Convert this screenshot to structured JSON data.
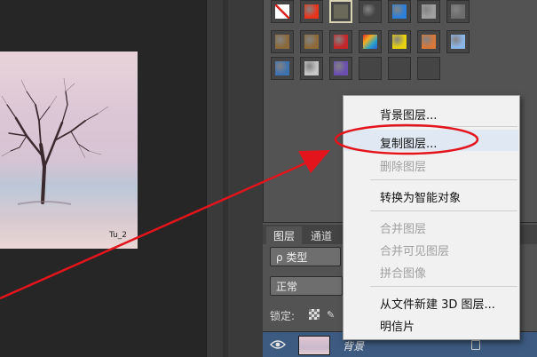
{
  "canvas": {
    "photo_label": "Tu_2"
  },
  "styles_panel": {
    "swatches": [
      {
        "name": "none-style",
        "color": "#ffffff"
      },
      {
        "name": "red-glow",
        "color": "#e8341c"
      },
      {
        "name": "outline-selected",
        "color": "#b5b39a"
      },
      {
        "name": "dark-chrome",
        "color": "#444444"
      },
      {
        "name": "blue-glass",
        "color": "#2d7fd9"
      },
      {
        "name": "gray-button",
        "color": "#a0a0a0"
      },
      {
        "name": "steel",
        "color": "#6d6d6d"
      },
      {
        "name": "bronze",
        "color": "#8a6a3a"
      },
      {
        "name": "brown-wood",
        "color": "#8c6a3a"
      },
      {
        "name": "red-emboss",
        "color": "#c4262a"
      },
      {
        "name": "rainbow-stripe",
        "color": "#2aa3c9"
      },
      {
        "name": "yellow-gel",
        "color": "#e6d10f"
      },
      {
        "name": "orange-gradient",
        "color": "#d8783a"
      },
      {
        "name": "light-blue",
        "color": "#8bb6e8"
      },
      {
        "name": "sky-scene",
        "color": "#3d72b0"
      },
      {
        "name": "texture-gray",
        "color": "#c6c6c6"
      },
      {
        "name": "purple-glass",
        "color": "#6a4fb0"
      },
      {
        "name": "empty-1",
        "color": "#454545"
      },
      {
        "name": "empty-2",
        "color": "#454545"
      },
      {
        "name": "empty-3",
        "color": "#454545"
      }
    ]
  },
  "layers_panel": {
    "tabs": [
      {
        "label": "图层"
      },
      {
        "label": "通道"
      }
    ],
    "filter": {
      "label": "ρ 类型"
    },
    "blend_mode": {
      "label": "正常"
    },
    "lock_label": "锁定:",
    "layer": {
      "name": "背景"
    }
  },
  "context_menu": {
    "items": [
      {
        "label": "背景图层...",
        "enabled": true
      },
      {
        "label": "复制图层...",
        "enabled": true,
        "highlighted": true
      },
      {
        "label": "删除图层",
        "enabled": false
      },
      {
        "label": "转换为智能对象",
        "enabled": true
      },
      {
        "label": "合并图层",
        "enabled": false
      },
      {
        "label": "合并可见图层",
        "enabled": false
      },
      {
        "label": "拼合图像",
        "enabled": false
      },
      {
        "label": "从文件新建 3D 图层...",
        "enabled": true
      },
      {
        "label": "明信片",
        "enabled": true
      }
    ]
  },
  "annotation_color": "#e3141b"
}
